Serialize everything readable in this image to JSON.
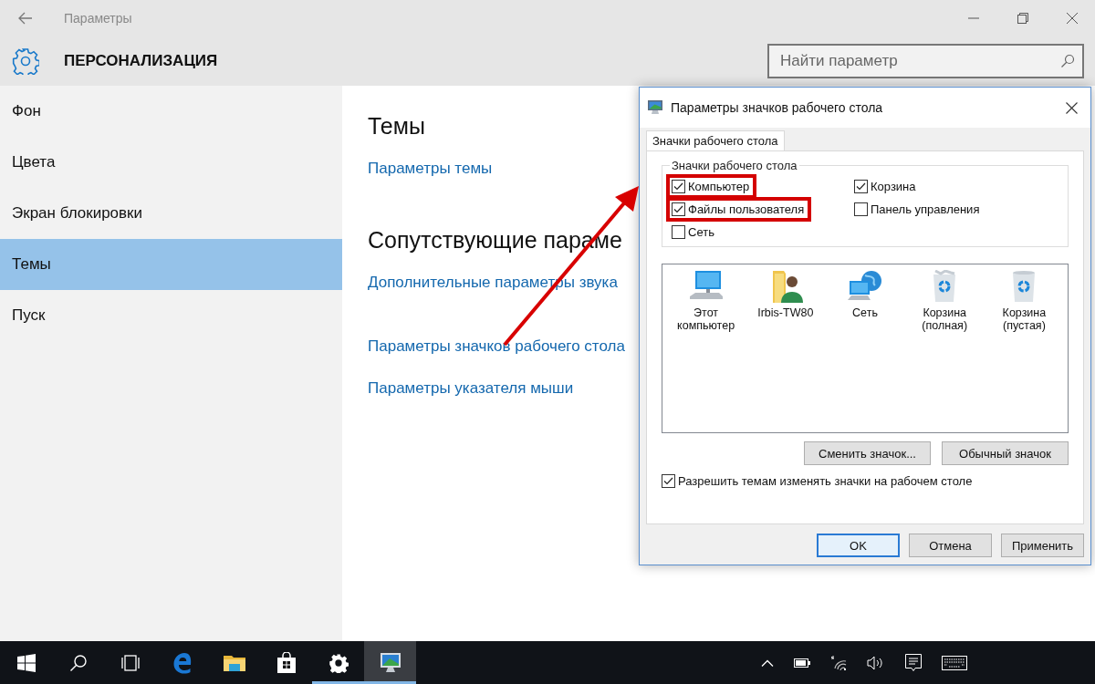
{
  "window": {
    "title": "Параметры",
    "section": "ПЕРСОНАЛИЗАЦИЯ",
    "search": {
      "placeholder": "Найти параметр"
    }
  },
  "sidebar": {
    "items": [
      {
        "label": "Фон",
        "selected": false
      },
      {
        "label": "Цвета",
        "selected": false
      },
      {
        "label": "Экран блокировки",
        "selected": false
      },
      {
        "label": "Темы",
        "selected": true
      },
      {
        "label": "Пуск",
        "selected": false
      }
    ]
  },
  "content": {
    "sections": [
      {
        "heading": "Темы",
        "links": [
          "Параметры темы"
        ]
      },
      {
        "heading": "Сопутствующие параме",
        "links": [
          "Дополнительные параметры звука",
          "Параметры значков рабочего стола",
          "Параметры указателя мыши"
        ]
      }
    ]
  },
  "dialog": {
    "title": "Параметры значков рабочего стола",
    "tabs": [
      {
        "label": "Значки рабочего стола",
        "selected": true
      }
    ],
    "group_label": "Значки рабочего стола",
    "checkboxes": [
      {
        "label": "Компьютер",
        "checked": true,
        "highlighted": true
      },
      {
        "label": "Корзина",
        "checked": true,
        "highlighted": false
      },
      {
        "label": "Файлы пользователя",
        "checked": true,
        "highlighted": true
      },
      {
        "label": "Панель управления",
        "checked": false,
        "highlighted": false
      },
      {
        "label": "Сеть",
        "checked": false,
        "highlighted": false
      }
    ],
    "icons": [
      {
        "kind": "computer",
        "label": "Этот компьютер"
      },
      {
        "kind": "user-folder",
        "label": "Irbis-TW80"
      },
      {
        "kind": "network",
        "label": "Сеть"
      },
      {
        "kind": "bin-full",
        "label": "Корзина (полная)"
      },
      {
        "kind": "bin-empty",
        "label": "Корзина (пустая)"
      }
    ],
    "icon_buttons": [
      "Сменить значок...",
      "Обычный значок"
    ],
    "allow_themes": {
      "label": "Разрешить темам изменять значки на рабочем столе",
      "checked": true
    },
    "buttons": [
      {
        "label": "OK",
        "default": true
      },
      {
        "label": "Отмена",
        "default": false
      },
      {
        "label": "Применить",
        "default": false
      }
    ]
  },
  "taskbar": {
    "apps": [
      {
        "kind": "start",
        "running": false,
        "active": false
      },
      {
        "kind": "search",
        "running": false,
        "active": false
      },
      {
        "kind": "task-view",
        "running": false,
        "active": false
      },
      {
        "kind": "edge",
        "running": false,
        "active": false
      },
      {
        "kind": "explorer",
        "running": false,
        "active": false
      },
      {
        "kind": "store",
        "running": false,
        "active": false
      },
      {
        "kind": "settings",
        "running": true,
        "active": false
      },
      {
        "kind": "desktop-icons",
        "running": true,
        "active": true
      }
    ],
    "tray": [
      {
        "kind": "chevron"
      },
      {
        "kind": "battery"
      },
      {
        "kind": "wifi"
      },
      {
        "kind": "volume"
      },
      {
        "kind": "notifications"
      },
      {
        "kind": "keyboard"
      }
    ]
  }
}
